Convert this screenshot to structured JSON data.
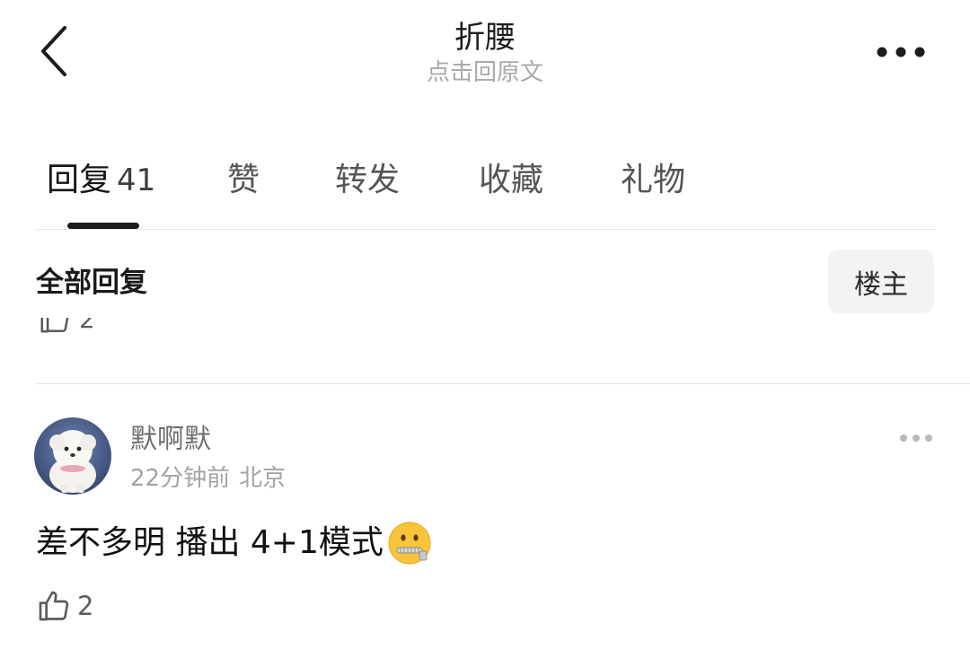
{
  "header": {
    "title": "折腰",
    "subtitle": "点击回原文"
  },
  "tabs": [
    {
      "label": "回复",
      "count": "41",
      "active": true
    },
    {
      "label": "赞"
    },
    {
      "label": "转发"
    },
    {
      "label": "收藏"
    },
    {
      "label": "礼物"
    }
  ],
  "replies_header": {
    "label": "全部回复",
    "op_button": "楼主"
  },
  "previous_comment": {
    "like_count": "2"
  },
  "comment": {
    "username": "默啊默",
    "time": "22分钟前",
    "location": "北京",
    "text": "差不多明 播出 4+1模式",
    "emoji": "zipper-mouth-face",
    "like_count": "2"
  },
  "icons": {
    "back": "chevron-left-icon",
    "more": "more-horizontal-icon",
    "like": "thumbs-up-icon"
  },
  "colors": {
    "primary_text": "#1c1c1c",
    "secondary_text": "#a9a9a9",
    "indicator": "#1c1c1c",
    "op_button_bg": "#f3f3f3"
  }
}
